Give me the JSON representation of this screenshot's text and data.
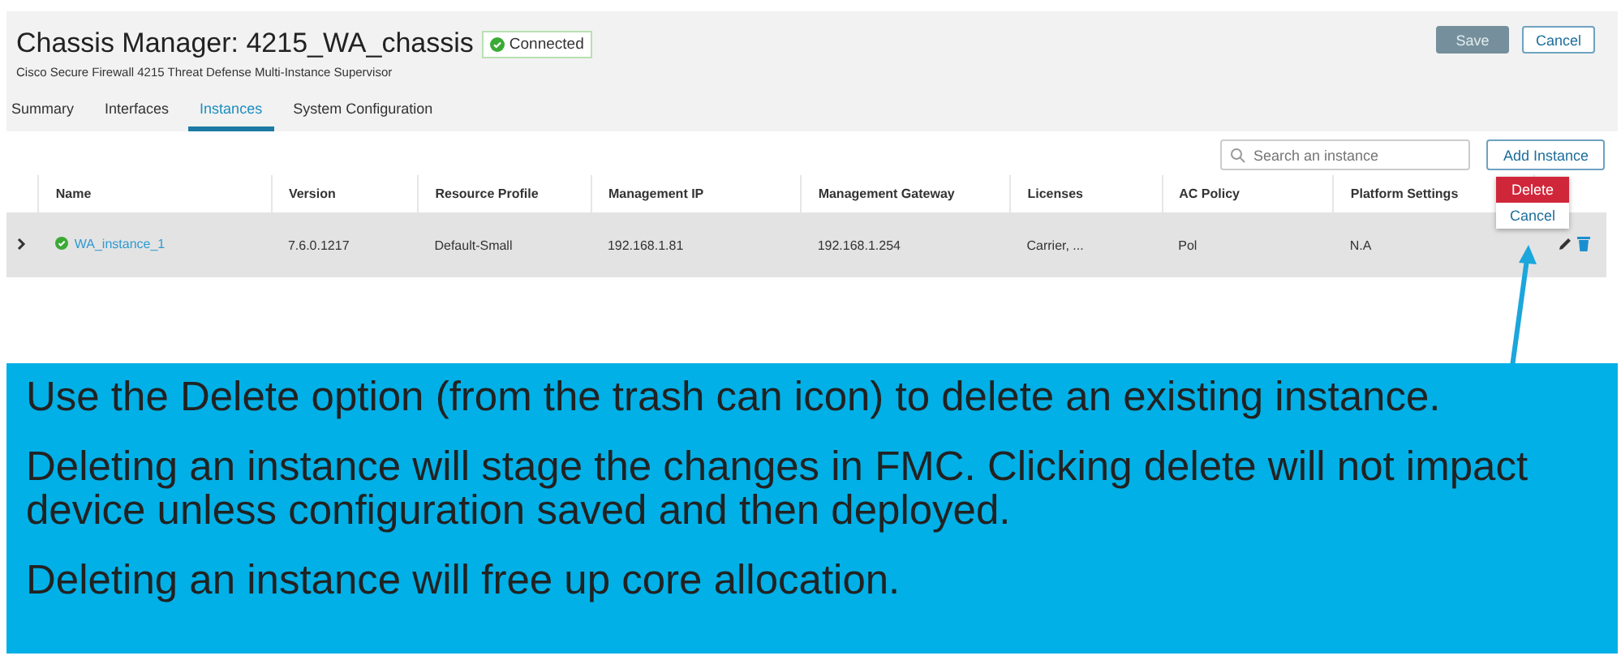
{
  "header": {
    "title": "Chassis Manager: 4215_WA_chassis",
    "status": "Connected",
    "subtitle": "Cisco Secure Firewall 4215 Threat Defense Multi-Instance Supervisor",
    "buttons": [
      "Save",
      "Cancel"
    ]
  },
  "tabs": [
    {
      "label": "Summary",
      "selected": false
    },
    {
      "label": "Interfaces",
      "selected": false
    },
    {
      "label": "Instances",
      "selected": true
    },
    {
      "label": "System Configuration",
      "selected": false
    }
  ],
  "search": {
    "placeholder": "Search an instance"
  },
  "add_button": "Add Instance",
  "table": {
    "columns": [
      "Name",
      "Version",
      "Resource Profile",
      "Management IP",
      "Management Gateway",
      "Licenses",
      "AC Policy",
      "Platform Settings"
    ],
    "rows": [
      {
        "expanded": false,
        "cells": [
          "WA_instance_1",
          "7.6.0.1217",
          "Default-Small",
          "192.168.1.81",
          "192.168.1.254",
          "Carrier, ...",
          "Pol",
          "N.A"
        ]
      }
    ]
  },
  "delete_menu": [
    "Delete",
    "Cancel"
  ],
  "callout": [
    "Use the Delete option (from the trash can icon) to delete an existing instance.",
    "Deleting an instance will stage the changes in FMC. Clicking delete will not impact device unless configuration saved and then deployed.",
    "Deleting an instance will free up core allocation."
  ]
}
